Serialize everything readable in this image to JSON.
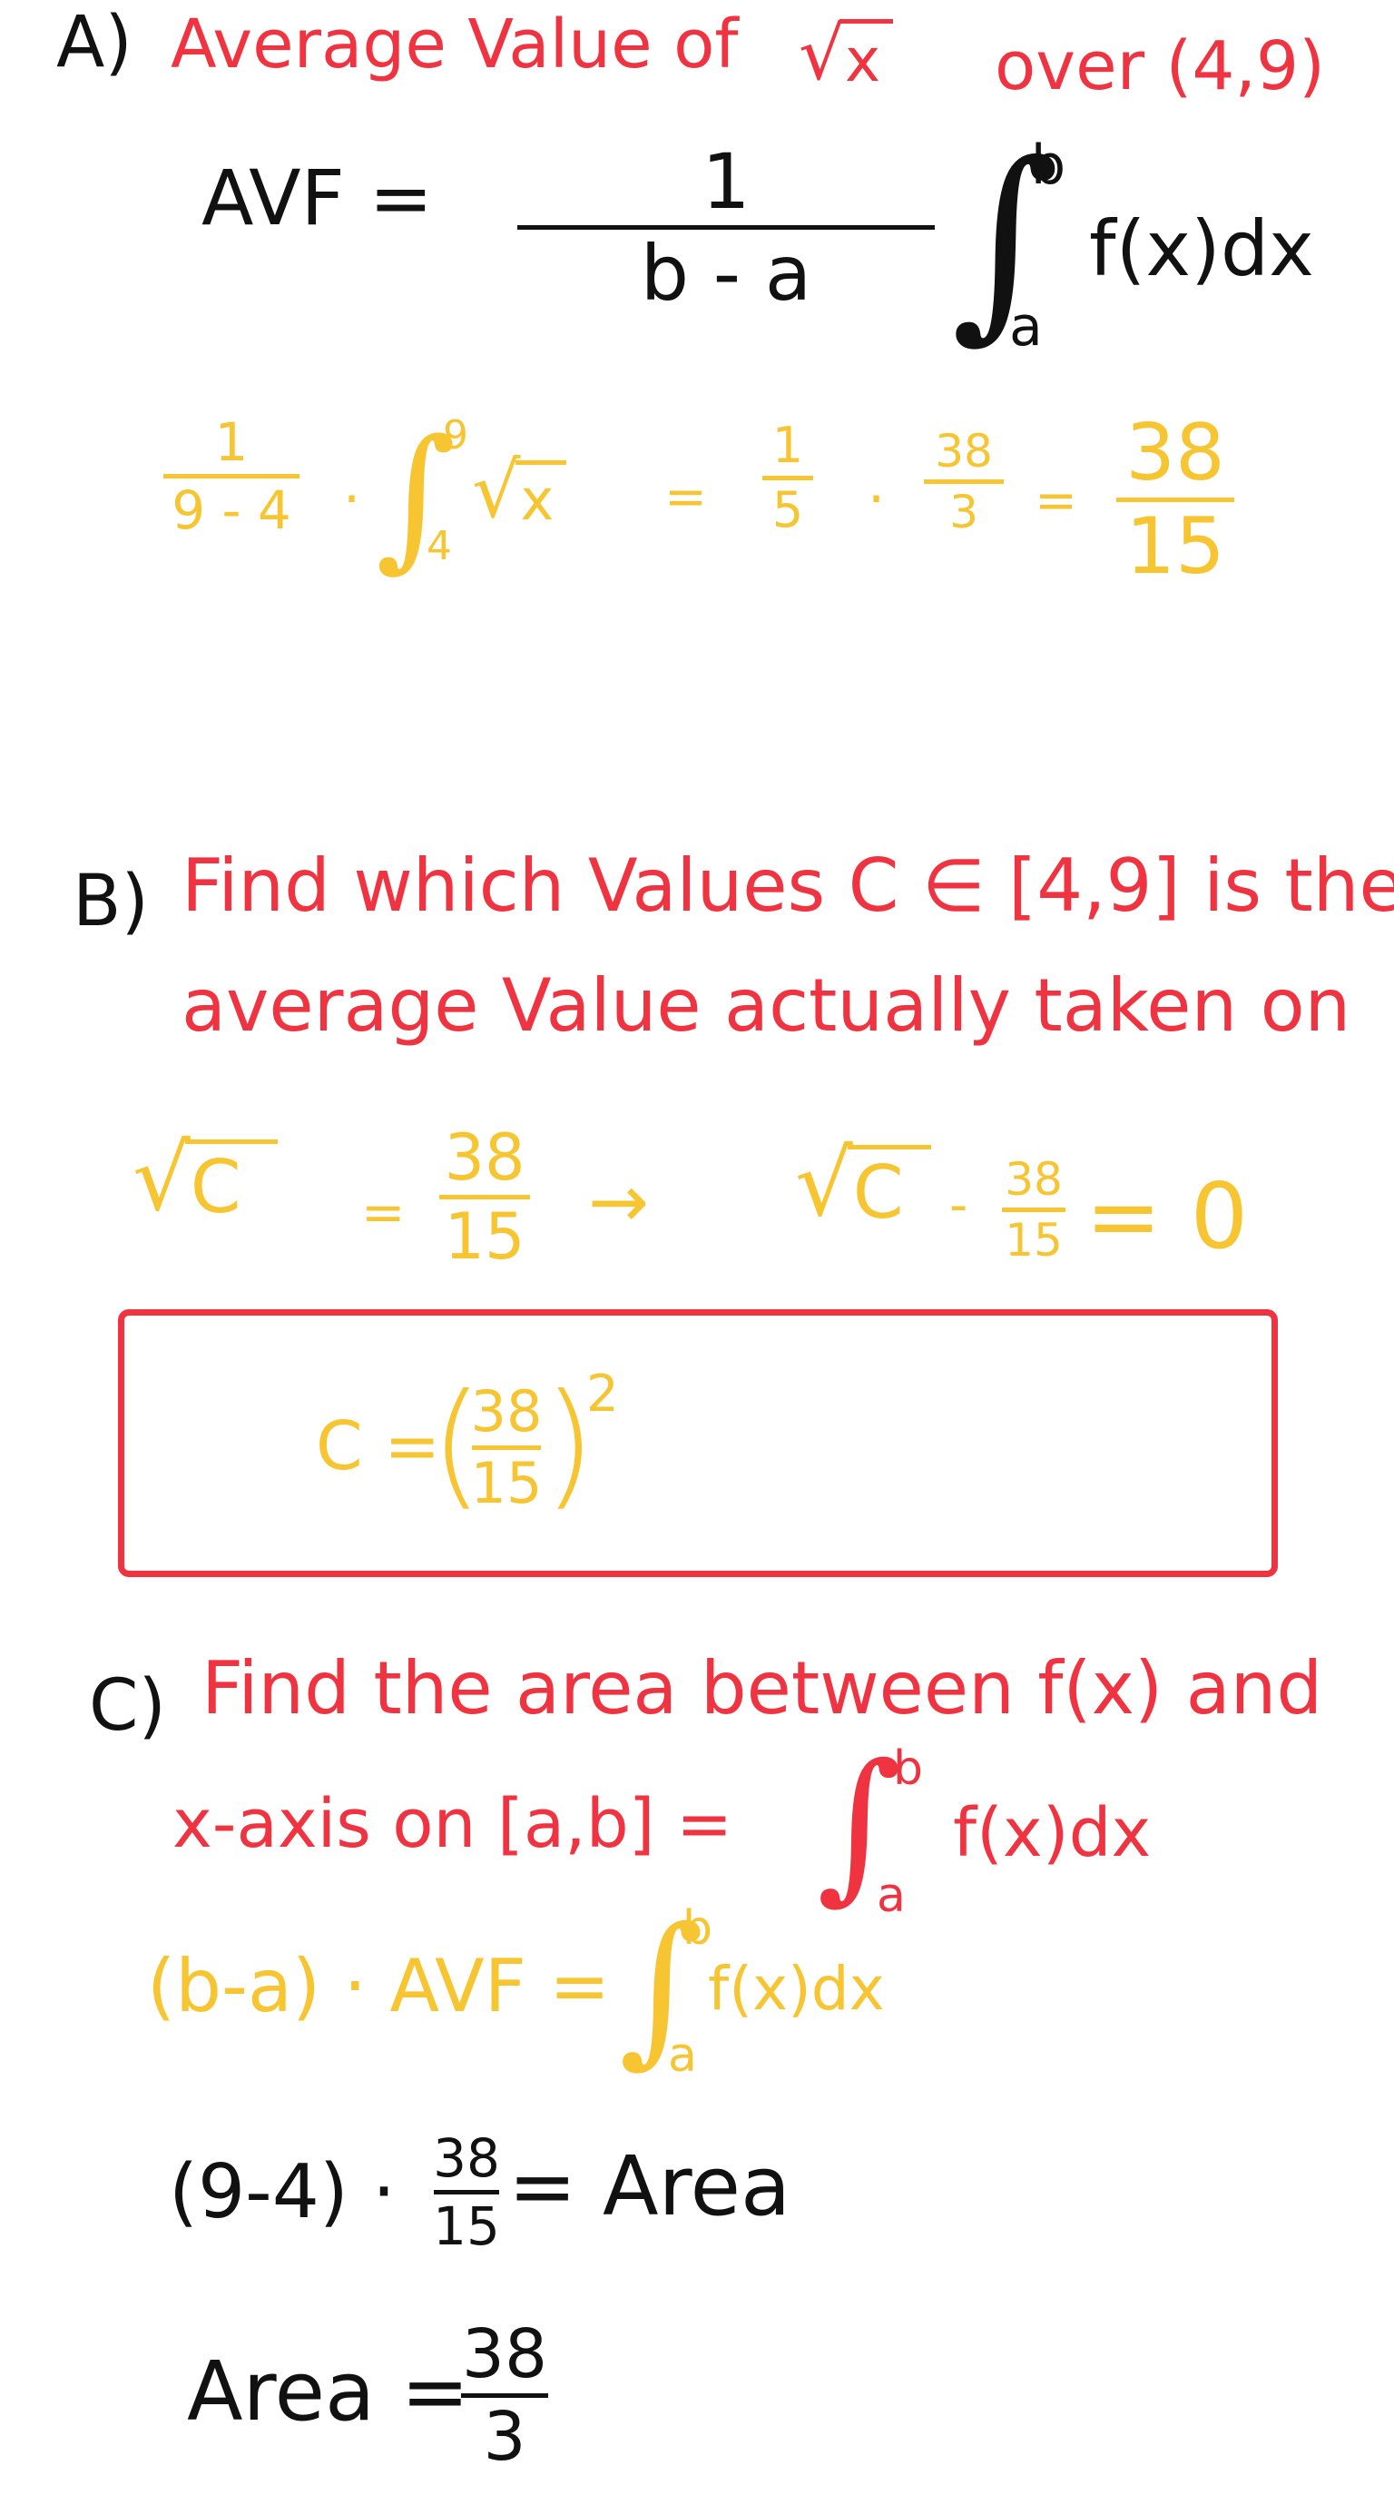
{
  "part_a": {
    "letter": "A)",
    "prompt_1": "Average Value of",
    "prompt_sqrt": "x",
    "prompt_2": "over (4,9)",
    "avf_label": "AVF =",
    "formula_num": "1",
    "formula_den": "b - a",
    "formula_int_top": "b",
    "formula_int_bottom": "a",
    "formula_integrand": "f(x)dx",
    "calc_num": "1",
    "calc_den": "9 - 4",
    "calc_dot": "·",
    "calc_int_top": "9",
    "calc_int_bottom": "4",
    "calc_sqrt": "x",
    "calc_eq1": "=",
    "calc_frac1_num": "1",
    "calc_frac1_den": "5",
    "calc_dot2": "·",
    "calc_frac2_num": "38",
    "calc_frac2_den": "3",
    "calc_eq2": "=",
    "calc_result_num": "38",
    "calc_result_den": "15"
  },
  "part_b": {
    "letter": "B)",
    "prompt_line1": "Find which Values C ∈ [4,9] is the",
    "prompt_line2": "average Value actually taken on",
    "eq_sqrt": "C",
    "eq_equals": "=",
    "eq_num": "38",
    "eq_den": "15",
    "arrow": "→",
    "eq2_sqrt": "C",
    "eq2_minus": "-",
    "eq2_num": "38",
    "eq2_den": "15",
    "eq2_tail": "= 0",
    "boxed_lhs": "C =",
    "boxed_num": "38",
    "boxed_den": "15",
    "boxed_exp": "2"
  },
  "part_c": {
    "letter": "C)",
    "prompt_line1": "Find the area between f(x) and",
    "prompt_line2": "x-axis on [a,b] =",
    "prompt_int_top": "b",
    "prompt_int_bottom": "a",
    "prompt_integrand": "f(x)dx",
    "yel_lhs": "(b-a) · AVF =",
    "yel_int_top": "b",
    "yel_int_bottom": "a",
    "yel_integrand": "f(x)dx",
    "line3_lhs": "(9-4) ·",
    "line3_num": "38",
    "line3_den": "15",
    "line3_rhs": "= Area",
    "line4_lhs": "Area =",
    "line4_num": "38",
    "line4_den": "3"
  },
  "colors": {
    "red": "#ef3340",
    "black": "#111111",
    "yellow": "#f7c531"
  }
}
